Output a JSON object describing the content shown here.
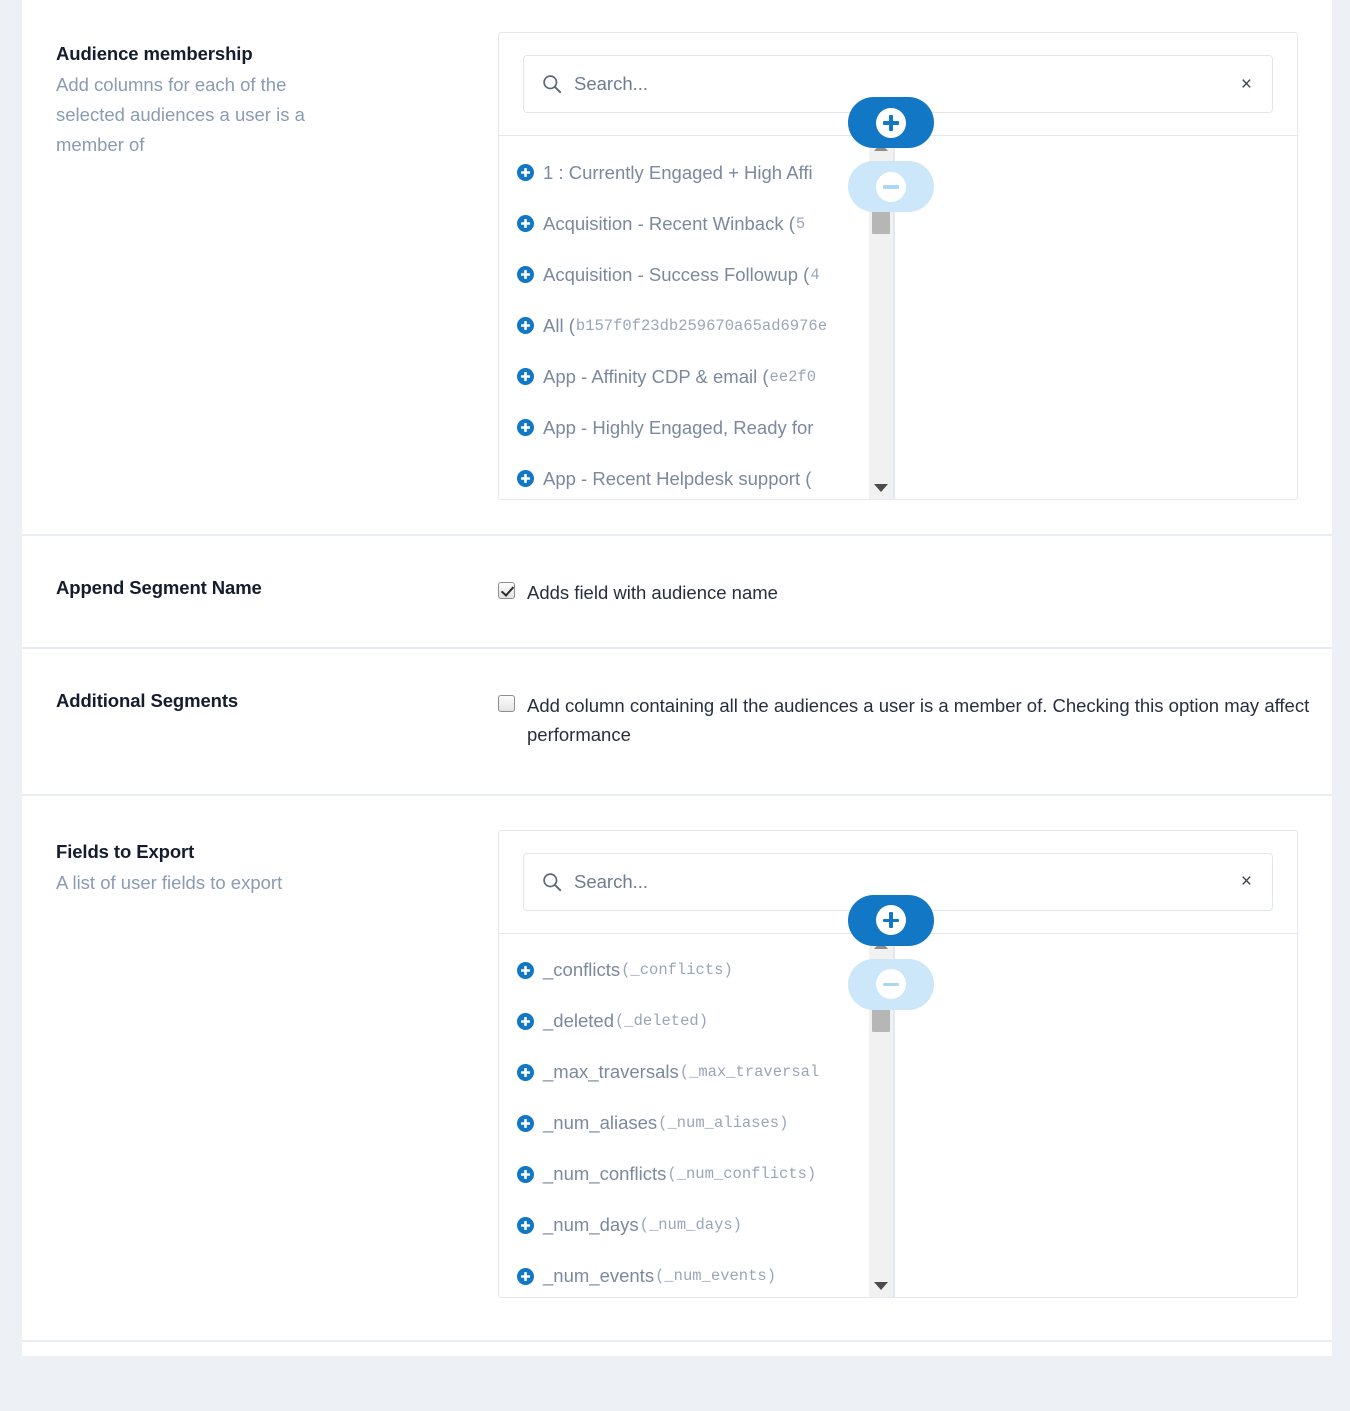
{
  "sections": [
    {
      "title": "Audience membership",
      "description": "Add columns for each of the selected audiences a user is a member of",
      "search": {
        "placeholder": "Search...",
        "value": "",
        "clear_label": "×",
        "icon": "search-icon"
      },
      "options": [
        {
          "label": "1 : Currently Engaged + High Affi",
          "id": ""
        },
        {
          "label": "Acquisition - Recent Winback (",
          "id": "5"
        },
        {
          "label": "Acquisition - Success Followup (",
          "id": "4"
        },
        {
          "label": "All (",
          "id": "b157f0f23db259670a65ad6976e"
        },
        {
          "label": "App - Affinity CDP & email (",
          "id": "ee2f0"
        },
        {
          "label": "App - Highly Engaged, Ready for",
          "id": ""
        },
        {
          "label": "App - Recent Helpdesk support (",
          "id": ""
        }
      ],
      "add_button_label": "add",
      "remove_button_label": "remove",
      "selected": []
    },
    {
      "title": "Fields to Export",
      "description": "A list of user fields to export",
      "search": {
        "placeholder": "Search...",
        "value": "",
        "clear_label": "×",
        "icon": "search-icon"
      },
      "options": [
        {
          "label": "_conflicts",
          "id": "(_conflicts)"
        },
        {
          "label": "_deleted",
          "id": "(_deleted)"
        },
        {
          "label": "_max_traversals",
          "id": "(_max_traversal"
        },
        {
          "label": "_num_aliases",
          "id": "(_num_aliases)"
        },
        {
          "label": "_num_conflicts",
          "id": "(_num_conflicts)"
        },
        {
          "label": "_num_days",
          "id": "(_num_days)"
        },
        {
          "label": "_num_events",
          "id": "(_num_events)"
        }
      ],
      "add_button_label": "add",
      "remove_button_label": "remove",
      "selected": []
    }
  ],
  "append_segment_name": {
    "title": "Append Segment Name",
    "checkbox_label": "Adds field with audience name",
    "checked": true
  },
  "additional_segments": {
    "title": "Additional Segments",
    "checkbox_label": "Add column containing all the audiences a user is a member of. Checking this option may affect performance",
    "checked": false
  },
  "colors": {
    "accent": "#1277c4",
    "accent_light": "#cbe7f9",
    "label_text": "#151c2e",
    "muted_text": "#8a9bb4",
    "divider": "#e8ecf3",
    "page_bg": "#edf0f5"
  }
}
